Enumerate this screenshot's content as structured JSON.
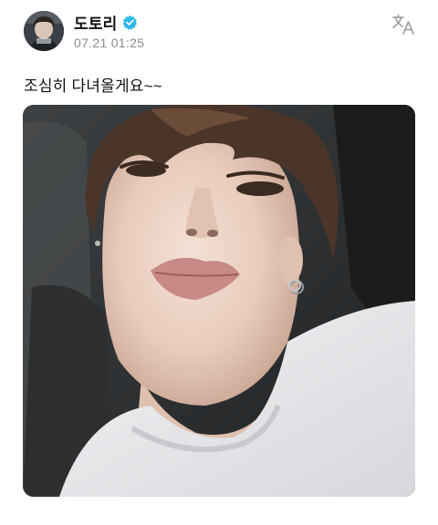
{
  "post": {
    "author": {
      "name": "도토리",
      "verified_icon": "verified-badge-icon",
      "avatar_icon": "avatar-image"
    },
    "timestamp": "07.21 01:25",
    "translate_icon": "translate-icon",
    "text": "조심히 다녀올게요~~",
    "photo_icon": "selfie-photo"
  },
  "colors": {
    "verified_badge": "#2fb8e8",
    "timestamp": "#8c8c8c",
    "text": "#111111"
  }
}
